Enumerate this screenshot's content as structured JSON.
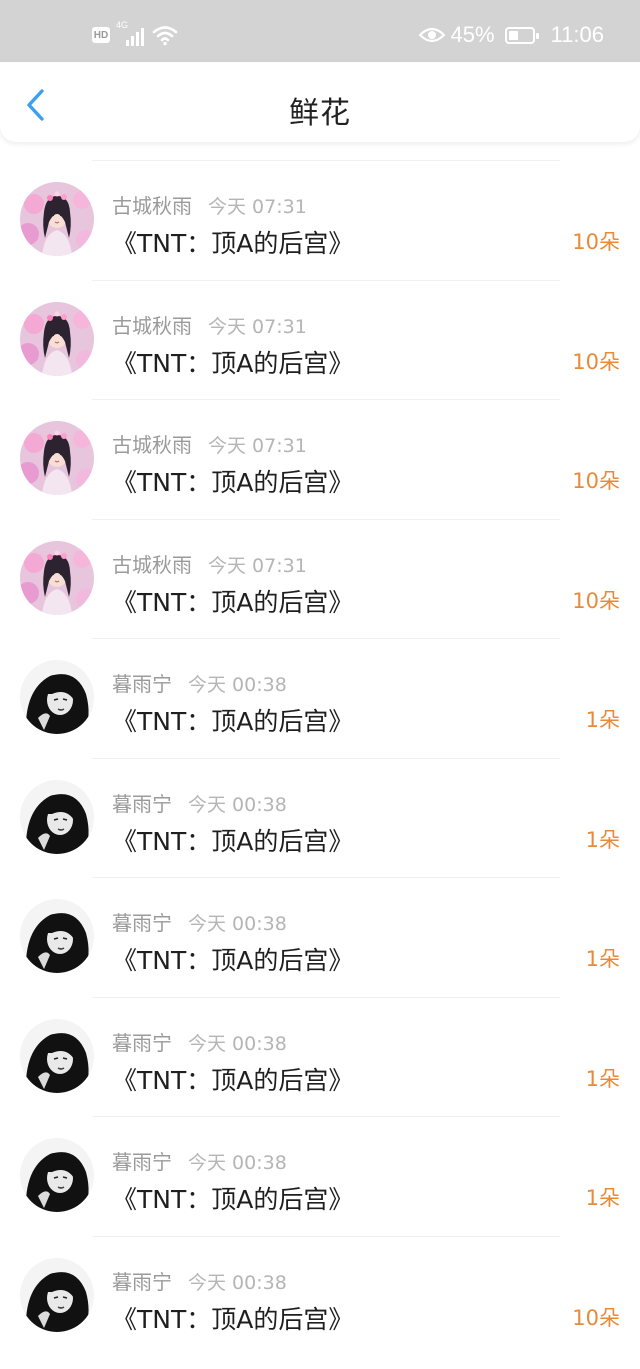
{
  "status_bar": {
    "network": "4G",
    "hd_label": "HD",
    "battery_percent": "45%",
    "battery_level": 0.45,
    "time": "11:06"
  },
  "header": {
    "title": "鲜花",
    "back_icon": "chevron-left-icon"
  },
  "colors": {
    "accent_back": "#3aa0f0",
    "count_orange": "#e78a3a",
    "status_bar_bg": "#d3d3d3"
  },
  "items": [
    {
      "name": "古城秋雨",
      "time": "今天 07:31",
      "title": "《TNT：顶A的后宫》",
      "count": "10朵",
      "avatar": "pink-floral-avatar"
    },
    {
      "name": "古城秋雨",
      "time": "今天 07:31",
      "title": "《TNT：顶A的后宫》",
      "count": "10朵",
      "avatar": "pink-floral-avatar"
    },
    {
      "name": "古城秋雨",
      "time": "今天 07:31",
      "title": "《TNT：顶A的后宫》",
      "count": "10朵",
      "avatar": "pink-floral-avatar"
    },
    {
      "name": "古城秋雨",
      "time": "今天 07:31",
      "title": "《TNT：顶A的后宫》",
      "count": "10朵",
      "avatar": "pink-floral-avatar"
    },
    {
      "name": "暮雨宁",
      "time": "今天 00:38",
      "title": "《TNT：顶A的后宫》",
      "count": "1朵",
      "avatar": "monochrome-portrait-avatar"
    },
    {
      "name": "暮雨宁",
      "time": "今天 00:38",
      "title": "《TNT：顶A的后宫》",
      "count": "1朵",
      "avatar": "monochrome-portrait-avatar"
    },
    {
      "name": "暮雨宁",
      "time": "今天 00:38",
      "title": "《TNT：顶A的后宫》",
      "count": "1朵",
      "avatar": "monochrome-portrait-avatar"
    },
    {
      "name": "暮雨宁",
      "time": "今天 00:38",
      "title": "《TNT：顶A的后宫》",
      "count": "1朵",
      "avatar": "monochrome-portrait-avatar"
    },
    {
      "name": "暮雨宁",
      "time": "今天 00:38",
      "title": "《TNT：顶A的后宫》",
      "count": "1朵",
      "avatar": "monochrome-portrait-avatar"
    },
    {
      "name": "暮雨宁",
      "time": "今天 00:38",
      "title": "《TNT：顶A的后宫》",
      "count": "10朵",
      "avatar": "monochrome-portrait-avatar"
    }
  ]
}
